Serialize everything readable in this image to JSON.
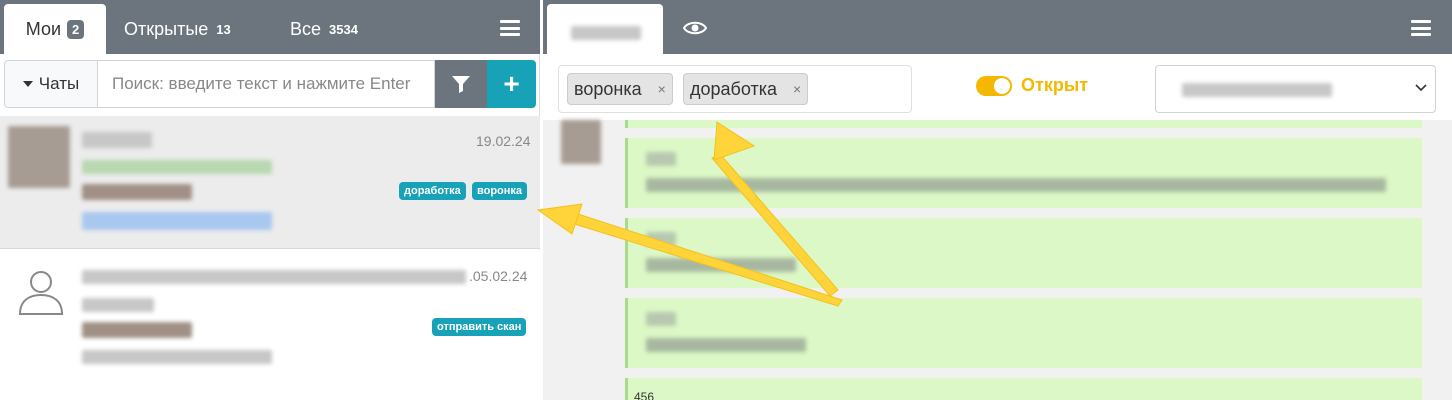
{
  "left_tabs": {
    "mine": {
      "label": "Мои",
      "count": "2"
    },
    "open": {
      "label": "Открытые",
      "count": "13"
    },
    "all": {
      "label": "Все",
      "count": "3534"
    }
  },
  "toolbar": {
    "chats_label": "Чаты",
    "search_placeholder": "Поиск: введите текст и нажмите Enter",
    "add_label": "+"
  },
  "conversations": [
    {
      "date": "19.02.24",
      "tags": [
        "доработка",
        "воронка"
      ]
    },
    {
      "date": ".05.02.24",
      "tags": [
        "отправить скан"
      ]
    }
  ],
  "chat_header": {
    "tags": [
      "воронка",
      "доработка"
    ],
    "tag_remove_label": "×",
    "status_label": "Открыт"
  },
  "message_fragment": "456",
  "colors": {
    "header_bg": "#6c757d",
    "accent": "#17a2b8",
    "status": "#f5b800",
    "bubble": "#dcf8c6"
  }
}
